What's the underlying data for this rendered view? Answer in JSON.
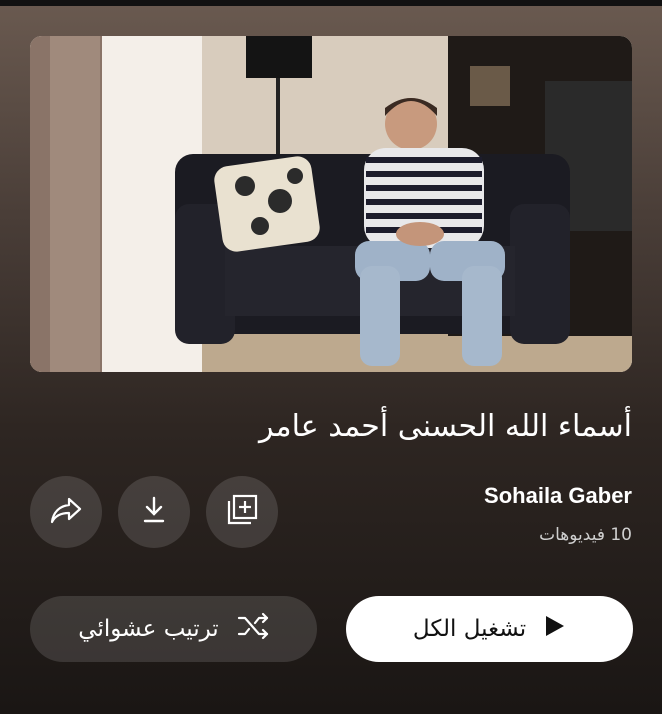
{
  "playlist": {
    "title": "أسماء الله الحسنى أحمد عامر",
    "author": "Sohaila Gaber",
    "video_count": "10 فيديوهات"
  },
  "actions": {
    "play_all_label": "تشغيل الكل",
    "shuffle_label": "ترتيب عشوائي",
    "add_icon": "add-to-library-icon",
    "download_icon": "download-icon",
    "share_icon": "share-icon"
  },
  "colors": {
    "play_button_bg": "#ffffff",
    "secondary_button_bg": "rgba(255,255,255,0.13)"
  }
}
